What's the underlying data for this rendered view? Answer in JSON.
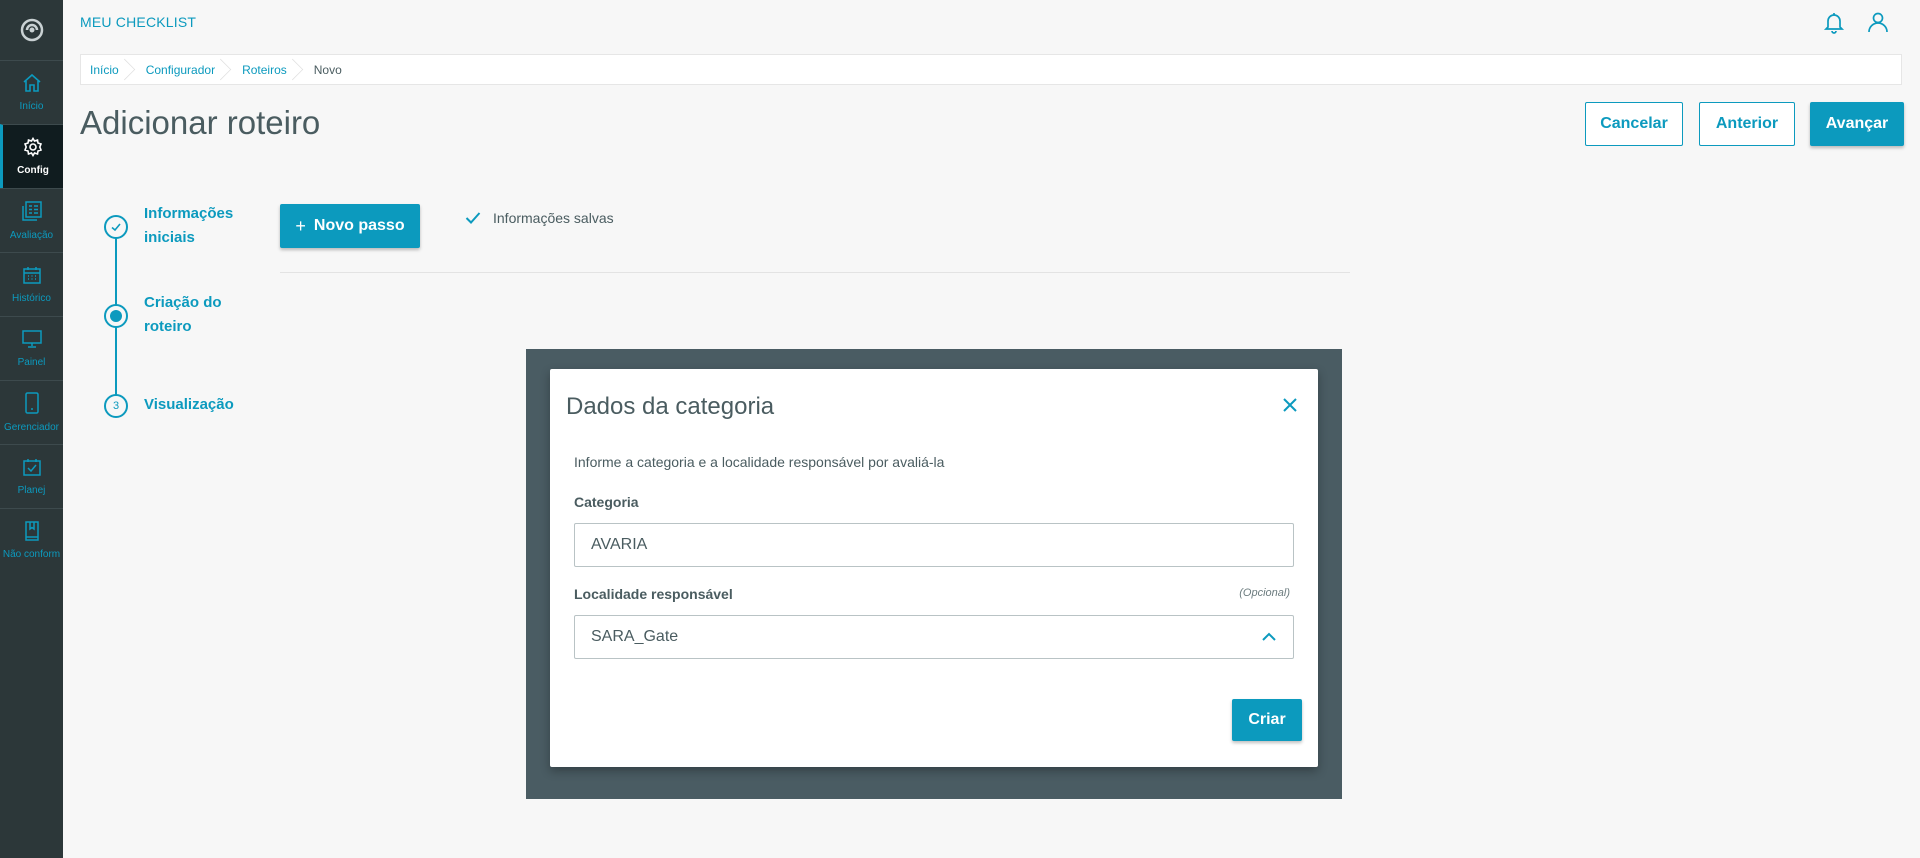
{
  "app": {
    "title": "MEU CHECKLIST"
  },
  "sidebar": {
    "items": [
      {
        "label": "Início",
        "icon": "home-icon",
        "active": false
      },
      {
        "label": "Config",
        "icon": "gear-icon",
        "active": true
      },
      {
        "label": "Avaliação",
        "icon": "checklist-icon",
        "active": false
      },
      {
        "label": "Histórico",
        "icon": "calendar-icon",
        "active": false
      },
      {
        "label": "Painel",
        "icon": "monitor-icon",
        "active": false
      },
      {
        "label": "Gerenciador",
        "icon": "mobile-icon",
        "active": false
      },
      {
        "label": "Planej",
        "icon": "calendar-check-icon",
        "active": false
      },
      {
        "label": "Não conform",
        "icon": "bookmark-icon",
        "active": false
      }
    ]
  },
  "breadcrumb": [
    "Início",
    "Configurador",
    "Roteiros",
    "Novo"
  ],
  "page": {
    "title": "Adicionar roteiro",
    "cancel_label": "Cancelar",
    "previous_label": "Anterior",
    "next_label": "Avançar"
  },
  "stepper": {
    "steps": [
      {
        "label_line1": "Informações",
        "label_line2": "iniciais",
        "state": "completed"
      },
      {
        "label_line1": "Criação do",
        "label_line2": "roteiro",
        "state": "current"
      },
      {
        "label_line1": "Visualização",
        "label_line2": "",
        "number": "3",
        "state": "pending"
      }
    ]
  },
  "main": {
    "new_step_label": "Novo passo",
    "saved_status": "Informações salvas"
  },
  "modal": {
    "title": "Dados da categoria",
    "description": "Informe a categoria e a localidade responsável por avaliá-la",
    "category_label": "Categoria",
    "category_value": "AVARIA",
    "locality_label": "Localidade responsável",
    "locality_optional": "(Opcional)",
    "locality_value": "SARA_Gate",
    "create_label": "Criar"
  },
  "colors": {
    "primary": "#0c9abe",
    "sidebar_bg": "#2c3739",
    "overlay": "#4a5c63",
    "text": "#4a5c60"
  }
}
